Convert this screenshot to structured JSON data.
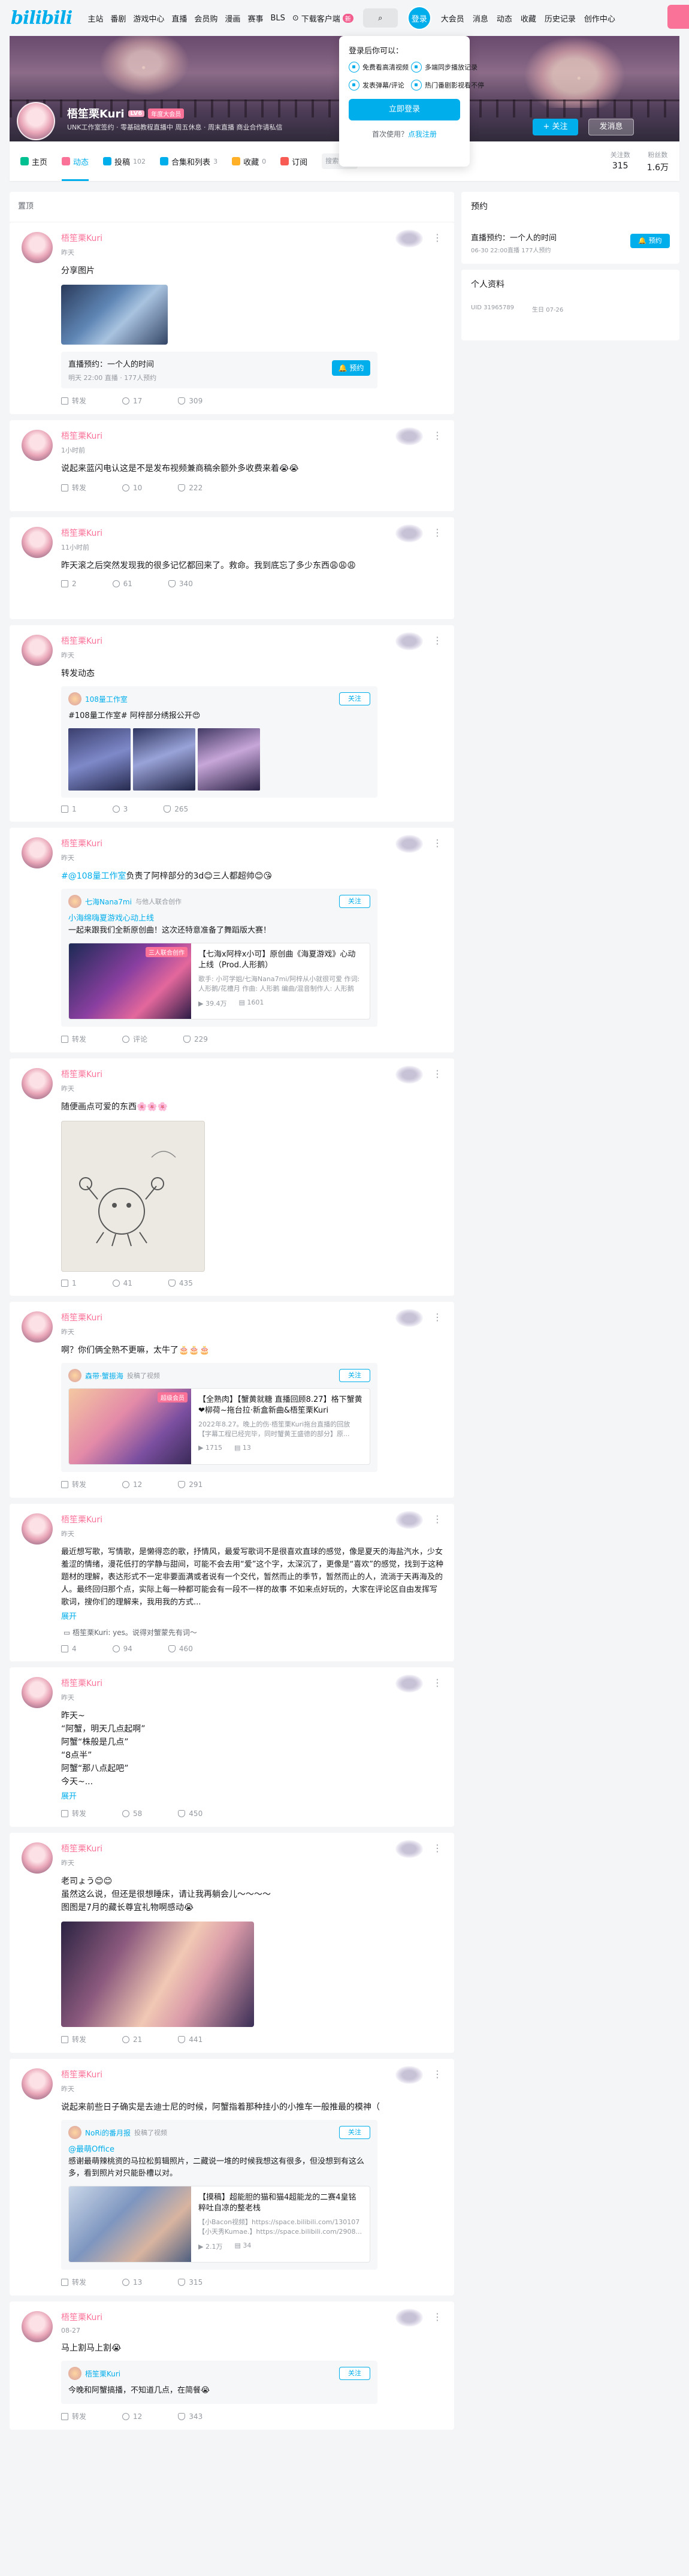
{
  "nav": {
    "logo": "bilibili",
    "links": [
      "主站",
      "番剧",
      "游戏中心",
      "直播",
      "会员购",
      "漫画",
      "赛事",
      "BLS"
    ],
    "download": "下载客户端",
    "download_badge": "新",
    "login": "登录",
    "right": [
      "大会员",
      "消息",
      "动态",
      "收藏",
      "历史记录",
      "创作中心"
    ]
  },
  "login_popup": {
    "title": "登录后你可以：",
    "perks": [
      "免费看高清视频",
      "多端同步播放记录",
      "发表弹幕/评论",
      "热门番剧影视看不停"
    ],
    "button": "立即登录",
    "register_prefix": "首次使用？",
    "register_link": "点我注册"
  },
  "profile": {
    "name": "梧笙栗Kuri",
    "level": "LV6",
    "vip": "年度大会员",
    "sign": "UNK工作室签约 · 零基础教程直播中  周五休息 · 周末直播  商业合作请私信",
    "follow": "+ 关注",
    "message": "发消息"
  },
  "tabs": [
    {
      "label": "主页",
      "count": "",
      "color": "#00c091"
    },
    {
      "label": "动态",
      "count": "",
      "color": "#fb7299"
    },
    {
      "label": "投稿",
      "count": "102",
      "color": "#00aeec"
    },
    {
      "label": "合集和列表",
      "count": "3",
      "color": "#00aeec"
    },
    {
      "label": "收藏",
      "count": "0",
      "color": "#ffb027"
    },
    {
      "label": "订阅",
      "count": "",
      "color": "#f85a54"
    }
  ],
  "tab_search_placeholder": "搜索视频",
  "stats": [
    {
      "label": "关注数",
      "value": "315"
    },
    {
      "label": "粉丝数",
      "value": "1.6万"
    }
  ],
  "main_head": "置顶",
  "side": {
    "reserve_title": "预约",
    "reserve_item": "直播预约：一个人的时间",
    "reserve_sub": "06-30 22:00直播 177人预约",
    "reserve_btn": "预约",
    "profile_title": "个人资料",
    "uid": "UID  31965789",
    "birthday": "生日  07-26"
  },
  "posts": [
    {
      "author": "梧笙栗Kuri",
      "time": "昨天",
      "text": "分享图片",
      "reserve": {
        "title": "直播预约：一个人的时间",
        "sub": "明天 22:00 直播 · 177人预约",
        "btn": "预约"
      },
      "share": "转发",
      "comment": "17",
      "like": "309"
    },
    {
      "author": "梧笙栗Kuri",
      "time": "1小时前",
      "text": "说起来蓝闪电认这是不是发布视频兼商稿余额外多收费来着😭😭",
      "share": "转发",
      "comment": "10",
      "like": "222"
    },
    {
      "author": "梧笙栗Kuri",
      "time": "11小时前",
      "text": "昨天滚之后突然发现我的很多记忆都回来了。救命。我到底忘了多少东西😩😩😩",
      "share": "2",
      "comment": "61",
      "like": "340"
    },
    {
      "author": "梧笙栗Kuri",
      "time": "昨天",
      "text": "转发动态",
      "fwd": {
        "name": "108量工作室",
        "extra": "",
        "btn": "关注",
        "text": "#108量工作室# 阿梓部分绣报公开😍"
      },
      "share": "1",
      "comment": "3",
      "like": "265"
    },
    {
      "author": "梧笙栗Kuri",
      "time": "昨天",
      "text_tag": "#@108量工作室",
      "text": "负责了阿梓部分的3d😊三人都超帅😊😘",
      "fwd": {
        "name": "七海Nana7mi",
        "extra": "与他人联合创作",
        "btn": "关注",
        "text_tag": "小海绵嗨夏游戏心动上线",
        "text": "一起来跟我们全新原创曲！这次还特意准备了舞蹈版大赛！"
      },
      "video": {
        "badge": "三人联合创作",
        "title": "【七海x阿梓x小可】原创曲《海夏游戏》心动上线（Prod.人形鹅）",
        "desc": "歌手: 小可学姐/七海Nana7mi/阿梓从小就很可爱 作词: 人形鹅/花槽月 作曲: 人形鹅 编曲/混音制作人: 人形鹅",
        "views": "39.4万",
        "danmaku": "1601"
      },
      "share": "转发",
      "comment": "评论",
      "like": "229"
    },
    {
      "author": "梧笙栗Kuri",
      "time": "昨天",
      "text": "随便画点可爱的东西🌸🌸🌸",
      "share": "1",
      "comment": "41",
      "like": "435"
    },
    {
      "author": "梧笙栗Kuri",
      "time": "昨天",
      "text": "啊？你们俩全熟不更嘛，太牛了🎂🎂🎂",
      "fwd": {
        "name": "森带·蟹振海",
        "extra": "投稿了视频",
        "btn": "关注"
      },
      "video": {
        "badge": "超级会员",
        "title": "【全熟肉】【蟹黄就糖 直播回顾8.27】格下蟹黄❤柳荷~拖台拉·新盒新曲&梧笙栗Kuri",
        "desc": "2022年8.27。晚上的伤·梧笙栗Kuri拖台直播的回放【字幕工程已经完毕，同时蟹黄王盛德的部分】原...",
        "views": "1715",
        "danmaku": "13"
      },
      "share": "转发",
      "comment": "12",
      "like": "291"
    },
    {
      "author": "梧笙栗Kuri",
      "time": "昨天",
      "text": "最近想写歌，写情歌，是懒得恋的歌，抒情风，最爱写歌词不是很喜欢直球的感觉，像是夏天的海盐汽水，少女羞涩的情绪，漫花低打的学静与甜间，可能不会去用“爱”这个字，太深沉了，更像是“喜欢”的感觉，找到于这种题材的理解，表达形式不一定非要面满或者说有一个交代，暂然而止的季节，暂然而止的人，流淌于天再海及的人。最终回归那个点，实际上每一种都可能会有一段不一样的故事 不如来点好玩的，大家在评论区自由发挥写歌词，搜你们的理解来，我用我的方式...",
      "expand": "展开",
      "comment_preview": "梧笙栗Kuri: yes。说得对蟹蒙先有词～",
      "share": "4",
      "comment": "94",
      "like": "460"
    },
    {
      "author": "梧笙栗Kuri",
      "time": "昨天",
      "text": "昨天~\n“阿蟹，明天几点起啊”\n阿蟹“株般是几点”\n“8点半”\n阿蟹“那八点起吧”\n今天~...",
      "expand": "展开",
      "share": "转发",
      "comment": "58",
      "like": "450"
    },
    {
      "author": "梧笙栗Kuri",
      "time": "昨天",
      "text": "老司ょう😊😊\n虽然这么说，但还是很想睡床，请让我再躺会儿～～～～\n图图是7月的藏长尊宜礼物啊感动😭",
      "share": "转发",
      "comment": "21",
      "like": "441"
    },
    {
      "author": "梧笙栗Kuri",
      "time": "昨天",
      "text": "说起来前些日子确实是去迪士尼的时候，阿蟹指着那种挂小的小推车一般推最的模神（",
      "fwd": {
        "name": "NoRi的番月报",
        "extra": "投稿了视频",
        "btn": "关注",
        "text_tag": "@最萌Office",
        "text": "感谢最萌辣桃资的马拉松剪辑照片，二藏说一堆的时候我想这有很多，但没想到有这么多，看到照片对只能卧槽以对。"
      },
      "video": {
        "badge": "",
        "title": "【摸稿】超能胆的猫和猫4超能龙的二赛4皇铭粹吐自凉的整老栈",
        "desc": "【小Bacon视频】https://space.bilibili.com/130107 【小天秀Kumae.】https://space.bilibili.com/2908...",
        "views": "2.1万",
        "danmaku": "34"
      },
      "share": "转发",
      "comment": "13",
      "like": "315"
    },
    {
      "author": "梧笙栗Kuri",
      "time": "08-27",
      "text": "马上割马上割😭",
      "fwd": {
        "name": "梧笙栗Kuri",
        "extra": "",
        "btn": "关注",
        "text": "今晚和阿蟹搞播，不知道几点，在简餐😭"
      },
      "share": "转发",
      "comment": "12",
      "like": "343"
    }
  ]
}
